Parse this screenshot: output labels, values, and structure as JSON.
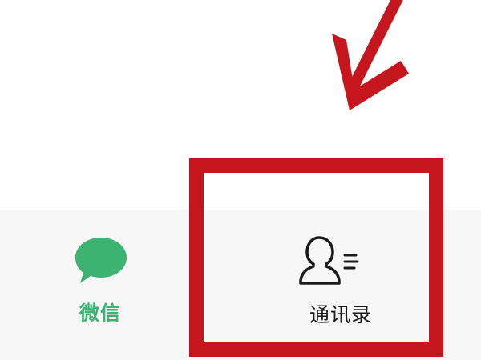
{
  "tab_bar": {
    "tabs": [
      {
        "id": "chats",
        "label": "微信",
        "icon": "chat-bubble-icon",
        "active": true,
        "color": "#3cb371"
      },
      {
        "id": "contacts",
        "label": "通讯录",
        "icon": "contacts-icon",
        "active": false,
        "color": "#1a1a1a"
      }
    ]
  },
  "annotation": {
    "color": "#c4161c",
    "shapes": [
      "arrow",
      "highlight-box"
    ]
  }
}
